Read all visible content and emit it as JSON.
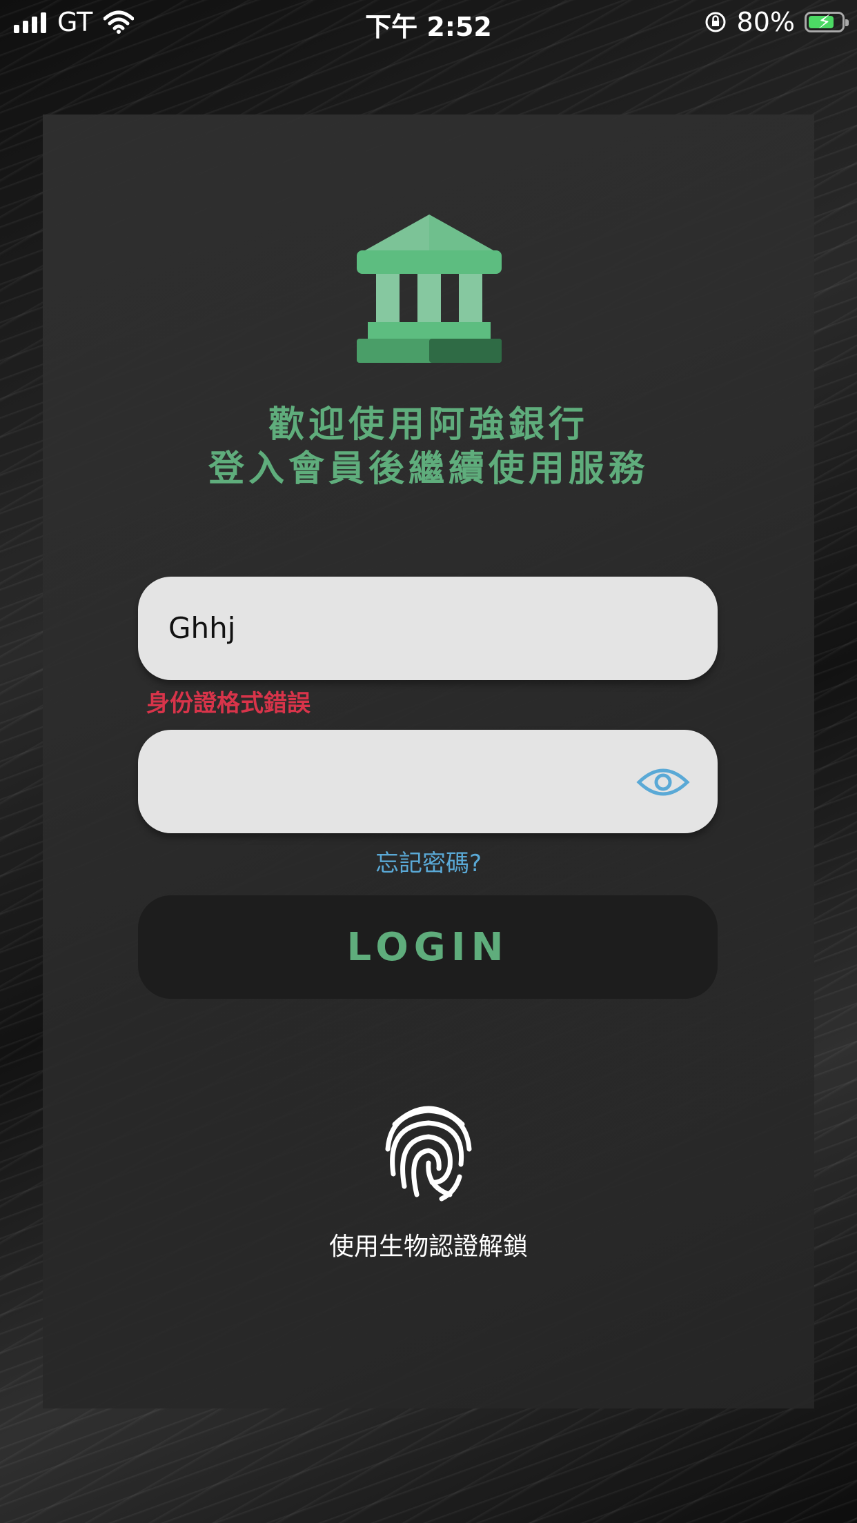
{
  "status_bar": {
    "carrier": "GT",
    "time": "下午 2:52",
    "battery_percent": "80%",
    "signal_bars": 4,
    "icons": [
      "cellular-signal-icon",
      "wifi-icon",
      "rotation-lock-icon",
      "battery-charging-icon"
    ]
  },
  "login": {
    "bank_icon": "bank-building-icon",
    "welcome_line1": "歡迎使用阿強銀行",
    "welcome_line2": "登入會員後繼續使用服務",
    "id_field_value": "Ghhj",
    "id_error": "身份證格式錯誤",
    "password_field_value": "",
    "password_toggle_icon": "eye-icon",
    "forgot_password": "忘記密碼?",
    "login_button": "LOGIN",
    "biometric_icon": "fingerprint-icon",
    "biometric_label": "使用生物認證解鎖"
  },
  "colors": {
    "accent_green": "#5fad7c",
    "error_red": "#d8344a",
    "link_blue": "#5aa9d6",
    "field_bg": "#e4e4e4",
    "button_bg": "#1d1d1d"
  }
}
